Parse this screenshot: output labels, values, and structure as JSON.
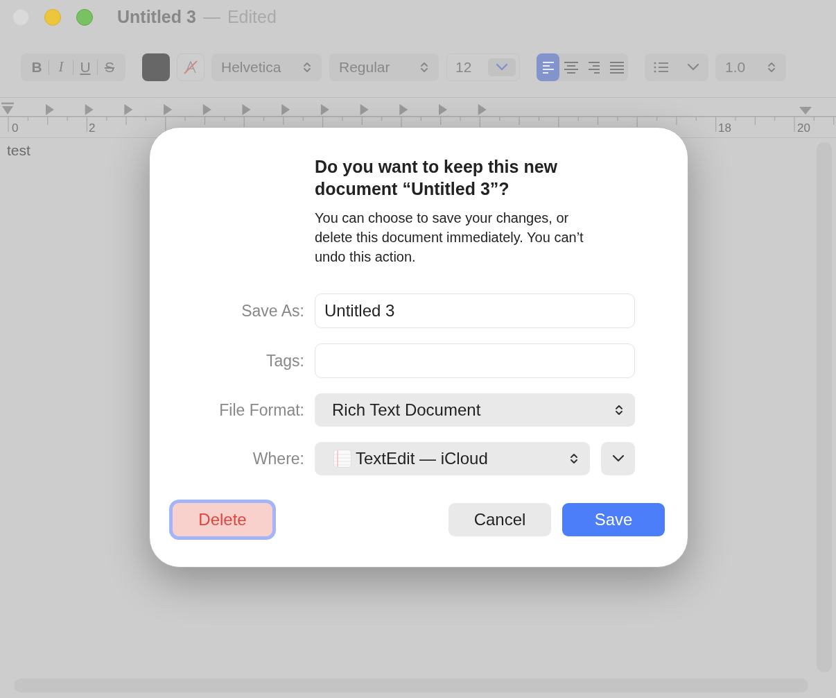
{
  "window": {
    "title": "Untitled 3",
    "separator": "—",
    "status": "Edited"
  },
  "toolbar": {
    "style_buttons": [
      {
        "label": "B",
        "kind": "bold"
      },
      {
        "label": "I",
        "kind": "italic"
      },
      {
        "label": "U",
        "kind": "underline"
      },
      {
        "label": "S",
        "kind": "strike"
      }
    ],
    "font_family": "Helvetica",
    "font_style": "Regular",
    "font_size": "12",
    "alignment": [
      {
        "kind": "left",
        "selected": true
      },
      {
        "kind": "center",
        "selected": false
      },
      {
        "kind": "right",
        "selected": false
      },
      {
        "kind": "justify",
        "selected": false
      }
    ],
    "line_spacing": "1.0"
  },
  "ruler": {
    "labels": [
      "0",
      "2",
      "18",
      "20"
    ]
  },
  "document": {
    "text": "test"
  },
  "dialog": {
    "heading": "Do you want to keep this new document “Untitled 3”?",
    "message": "You can choose to save your changes, or delete this document immediately. You can’t undo this action.",
    "fields": [
      {
        "label": "Save As:",
        "kind": "text",
        "value": "Untitled 3"
      },
      {
        "label": "Tags:",
        "kind": "text"
      },
      {
        "label": "File Format:",
        "kind": "popup",
        "value": "Rich Text Document"
      },
      {
        "label": "Where:",
        "kind": "location",
        "value": "TextEdit — iCloud"
      }
    ],
    "buttons": [
      {
        "label": "Delete",
        "kind": "destructive",
        "focused": true
      },
      {
        "label": "Cancel",
        "kind": "normal",
        "focused": false
      },
      {
        "label": "Save",
        "kind": "default",
        "focused": false
      }
    ]
  }
}
